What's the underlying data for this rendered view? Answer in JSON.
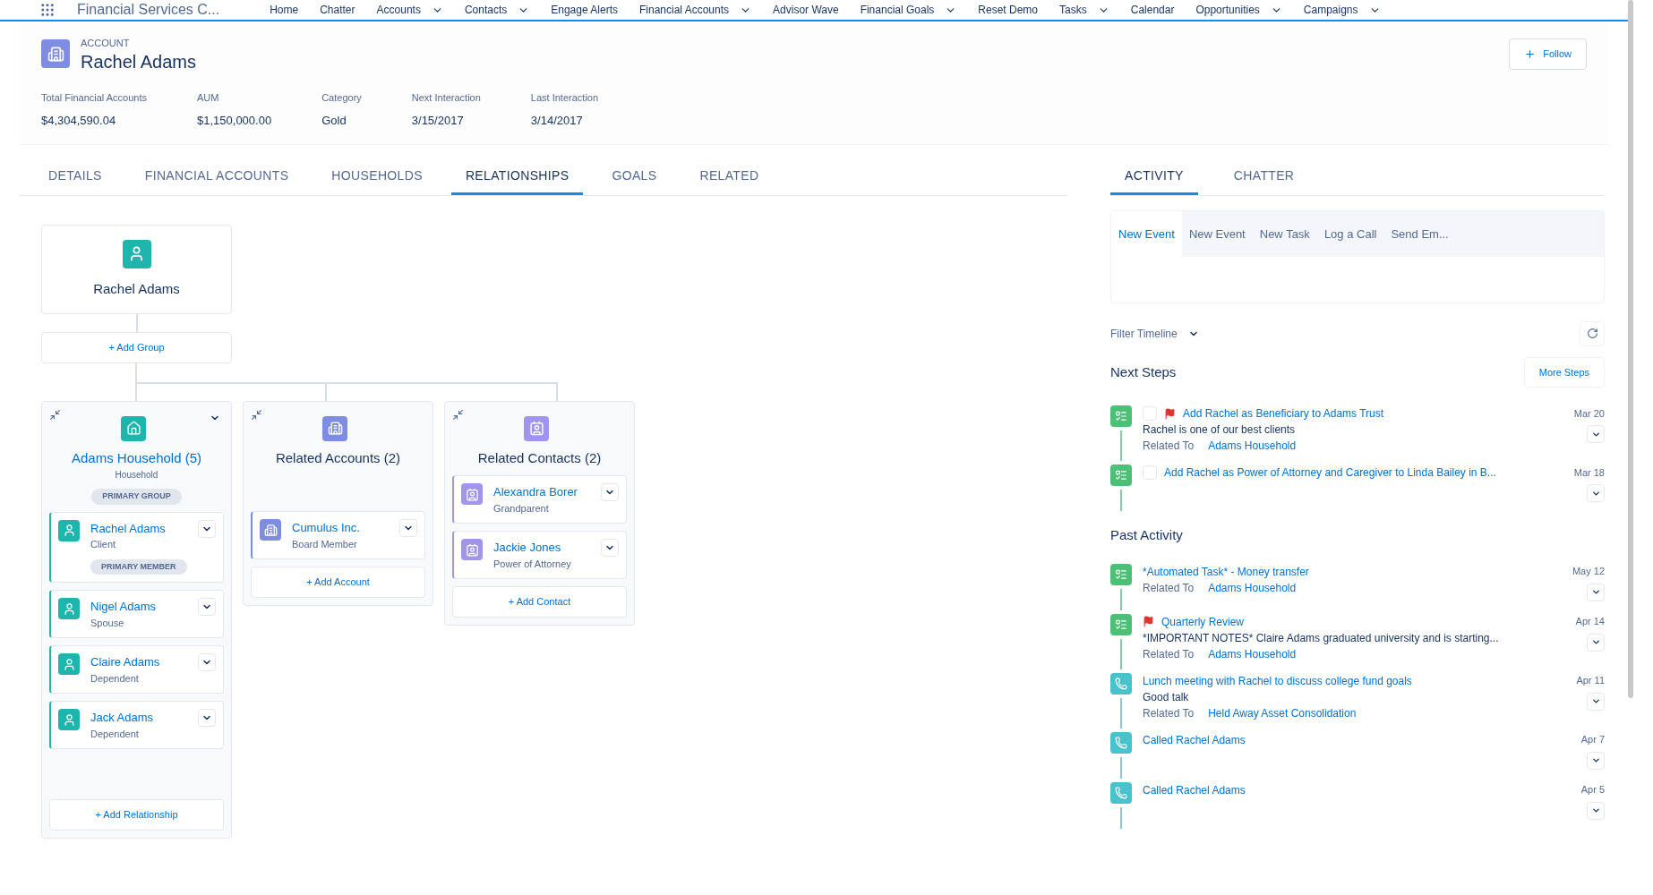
{
  "nav": {
    "app_name": "Financial Services C...",
    "items": [
      {
        "label": "Home",
        "dropdown": false
      },
      {
        "label": "Chatter",
        "dropdown": false
      },
      {
        "label": "Accounts",
        "dropdown": true
      },
      {
        "label": "Contacts",
        "dropdown": true
      },
      {
        "label": "Engage Alerts",
        "dropdown": false
      },
      {
        "label": "Financial Accounts",
        "dropdown": true
      },
      {
        "label": "Advisor Wave",
        "dropdown": false
      },
      {
        "label": "Financial Goals",
        "dropdown": true
      },
      {
        "label": "Reset Demo",
        "dropdown": false
      },
      {
        "label": "Tasks",
        "dropdown": true
      },
      {
        "label": "Calendar",
        "dropdown": false
      },
      {
        "label": "Opportunities",
        "dropdown": true
      },
      {
        "label": "Campaigns",
        "dropdown": true
      }
    ]
  },
  "header": {
    "object_type": "ACCOUNT",
    "title": "Rachel Adams",
    "follow_button": "Follow",
    "fields": [
      {
        "label": "Total Financial Accounts",
        "value": "$4,304,590.04"
      },
      {
        "label": "AUM",
        "value": "$1,150,000.00"
      },
      {
        "label": "Category",
        "value": "Gold"
      },
      {
        "label": "Next Interaction",
        "value": "3/15/2017"
      },
      {
        "label": "Last Interaction",
        "value": "3/14/2017"
      }
    ]
  },
  "tabs": [
    {
      "label": "DETAILS",
      "selected": false
    },
    {
      "label": "FINANCIAL ACCOUNTS",
      "selected": false
    },
    {
      "label": "HOUSEHOLDS",
      "selected": false
    },
    {
      "label": "RELATIONSHIPS",
      "selected": true
    },
    {
      "label": "GOALS",
      "selected": false
    },
    {
      "label": "RELATED",
      "selected": false
    }
  ],
  "relationship_tree": {
    "root": "Rachel Adams",
    "add_group": "+ Add Group",
    "groups": [
      {
        "kind": "household",
        "title": "Adams Household (5)",
        "subtitle": "Household",
        "badge": "PRIMARY GROUP",
        "add_button": "+ Add Relationship",
        "members": [
          {
            "name": "Rachel Adams",
            "role": "Client",
            "badge": "PRIMARY MEMBER"
          },
          {
            "name": "Nigel Adams",
            "role": "Spouse"
          },
          {
            "name": "Claire Adams",
            "role": "Dependent"
          },
          {
            "name": "Jack Adams",
            "role": "Dependent"
          }
        ]
      },
      {
        "kind": "account",
        "title": "Related Accounts (2)",
        "add_button": "+ Add Account",
        "members": [
          {
            "name": "Cumulus Inc.",
            "role": "Board Member"
          }
        ]
      },
      {
        "kind": "contact",
        "title": "Related Contacts (2)",
        "add_button": "+ Add Contact",
        "members": [
          {
            "name": "Alexandra Borer",
            "role": "Grandparent"
          },
          {
            "name": "Jackie Jones",
            "role": "Power of Attorney"
          }
        ]
      }
    ]
  },
  "activity": {
    "tabs": [
      {
        "label": "ACTIVITY",
        "selected": true
      },
      {
        "label": "CHATTER",
        "selected": false
      }
    ],
    "composer_tabs": [
      {
        "label": "New Event",
        "selected": true
      },
      {
        "label": "New Event",
        "selected": false
      },
      {
        "label": "New Task",
        "selected": false
      },
      {
        "label": "Log a Call",
        "selected": false
      },
      {
        "label": "Send Em...",
        "selected": false
      }
    ],
    "filter": "Filter Timeline",
    "sections": [
      {
        "title": "Next Steps",
        "button": "More Steps",
        "items": [
          {
            "kind": "task",
            "completable": true,
            "checked": false,
            "flagged": true,
            "title": "Add Rachel as Beneficiary to Adams Trust",
            "date": "Mar 20",
            "description": "Rachel is one of our best clients",
            "related_label": "Related To",
            "related": "Adams Household"
          },
          {
            "kind": "task",
            "completable": true,
            "checked": false,
            "flagged": false,
            "title": "Add Rachel as Power of Attorney and Caregiver to Linda Bailey in B...",
            "date": "Mar 18"
          }
        ]
      },
      {
        "title": "Past Activity",
        "items": [
          {
            "kind": "task",
            "completable": false,
            "flagged": false,
            "title": "*Automated Task* - Money transfer",
            "date": "May 12",
            "related_label": "Related To",
            "related": "Adams Household"
          },
          {
            "kind": "task",
            "completable": false,
            "flagged": true,
            "title": "Quarterly Review",
            "date": "Apr 14",
            "description": "*IMPORTANT NOTES* Claire Adams graduated university and is starting...",
            "related_label": "Related To",
            "related": "Adams Household"
          },
          {
            "kind": "call",
            "completable": false,
            "flagged": false,
            "title": "Lunch meeting with Rachel to discuss college fund goals",
            "date": "Apr 11",
            "description": "Good talk",
            "related_label": "Related To",
            "related": "Held Away Asset Consolidation"
          },
          {
            "kind": "call",
            "completable": false,
            "flagged": false,
            "title": "Called Rachel Adams",
            "date": "Apr 7"
          },
          {
            "kind": "call",
            "completable": false,
            "flagged": false,
            "title": "Called Rachel Adams",
            "date": "Apr 5"
          }
        ]
      }
    ]
  }
}
